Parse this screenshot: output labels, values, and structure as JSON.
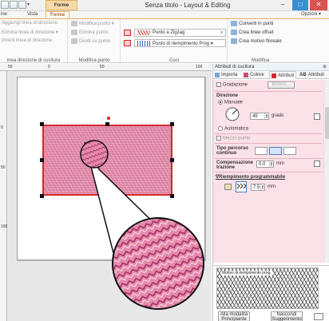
{
  "window": {
    "title": "Senza titolo - Layout & Editing",
    "context_tab": "Forme",
    "controls": {
      "minimize": "–",
      "maximize": "□",
      "close": "✕"
    }
  },
  "ribbon": {
    "tabs": [
      {
        "label": "ine"
      },
      {
        "label": "Vista"
      },
      {
        "label": "Forme"
      }
    ],
    "options_label": "Opzioni ▾",
    "groups": {
      "sewing_direction": {
        "caption": "inea direzione di cucitura",
        "items": [
          "Aggiungi linea di direzione",
          "Elimina linea di direzione ▾",
          "Inverti linea di direzione"
        ]
      },
      "modify_point": {
        "caption": "Modifica punto",
        "items": [
          "Modifica punto ▾",
          "Elimina punto",
          "Dividi su punto"
        ]
      },
      "stitches": {
        "caption": "Cuci",
        "line_stitch": "Punto a Zigzag",
        "fill_stitch": "Punto di riempimento Prog ▾"
      },
      "modify": {
        "caption": "Modifica",
        "items": [
          "Converti in punti",
          "Crea linee offset",
          "Crea motivo floreale"
        ]
      }
    }
  },
  "rulers": {
    "horizontal": [
      "50",
      "0",
      "50",
      "100"
    ],
    "vertical": [
      "0",
      "50",
      "100"
    ]
  },
  "panel": {
    "title": "Attributi di cucitura",
    "pin": "⊕",
    "tabs": [
      "Importa",
      "Colore",
      "Attributi",
      "Attributi"
    ],
    "gradation_label": "Gradazione",
    "motif_button": "Motivo...",
    "direction_label": "Direzione",
    "manual_label": "Manuale",
    "angle_value": "45",
    "angle_unit": "grado",
    "automatic_label": "Automatica",
    "half_stitch_label": "Mezzo punto",
    "path_type_label": "Tipo percorso continuo",
    "pull_comp_label": "Compensazione trazione",
    "pull_comp_value": "0.0",
    "pull_comp_unit": "mm",
    "prog_fill_label": "∇Riempimento programmabile",
    "pattern_size_value": "7.5",
    "pattern_size_unit": "mm",
    "preview_caption": "Motivo di riempimento prog.",
    "beginner_button": "Alla modalità Principiante",
    "hide_hint_button": "Nascondi Suggerimento"
  },
  "colors": {
    "accent": "#e3b062",
    "stitch_fill": "#e38dac",
    "stitch_outline": "#d8262b"
  }
}
